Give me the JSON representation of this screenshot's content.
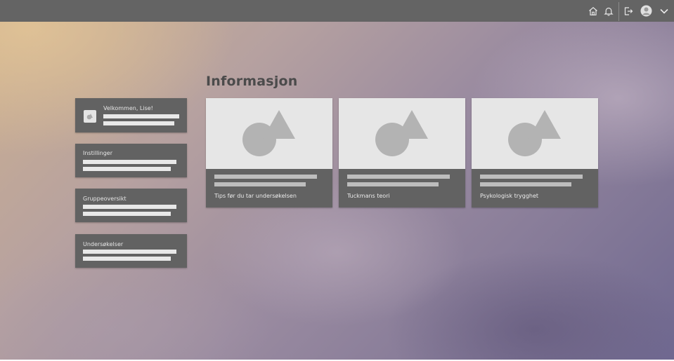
{
  "header": {
    "icons": {
      "home": "home-icon",
      "notifications": "bell-icon",
      "logout": "logout-icon",
      "avatar": "avatar-icon",
      "menu": "chevron-down-icon"
    }
  },
  "main": {
    "title": "Informasjon"
  },
  "sidebar": {
    "cards": [
      {
        "label": "Velkommen, Lise!"
      },
      {
        "label": "Instillinger"
      },
      {
        "label": "Gruppeoversikt"
      },
      {
        "label": "Undersøkelser"
      }
    ]
  },
  "info_cards": [
    {
      "caption": "Tips før du tar undersøkelsen"
    },
    {
      "caption": "Tuckmans teori"
    },
    {
      "caption": "Psykologisk trygghet"
    }
  ],
  "colors": {
    "topbar": "#646464",
    "card": "#626262",
    "placeholder_image": "#e6e6e6",
    "placeholder_shape": "#b3b3b3"
  }
}
